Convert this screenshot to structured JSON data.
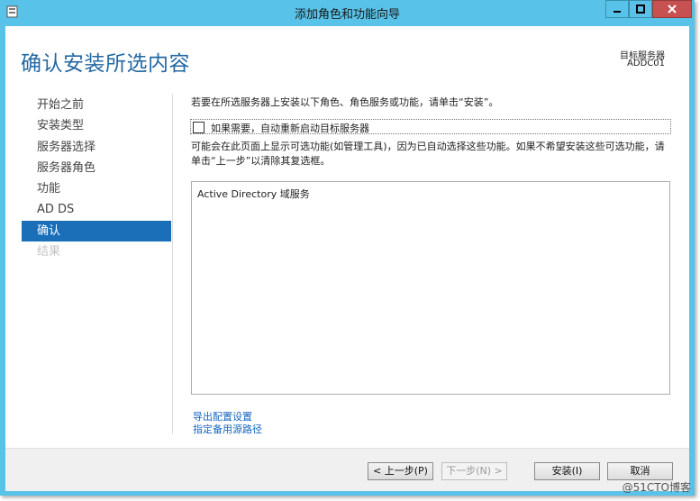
{
  "window": {
    "title": "添加角色和功能向导",
    "accent": "#58c2e8"
  },
  "header": {
    "heading": "确认安装所选内容",
    "target_label": "目标服务器",
    "target_value": "ADDC01"
  },
  "nav": {
    "items": [
      {
        "label": "开始之前",
        "state": "normal"
      },
      {
        "label": "安装类型",
        "state": "normal"
      },
      {
        "label": "服务器选择",
        "state": "normal"
      },
      {
        "label": "服务器角色",
        "state": "normal"
      },
      {
        "label": "功能",
        "state": "normal"
      },
      {
        "label": "AD DS",
        "state": "normal"
      },
      {
        "label": "确认",
        "state": "active"
      },
      {
        "label": "结果",
        "state": "disabled"
      }
    ]
  },
  "content": {
    "instruction": "若要在所选服务器上安装以下角色、角色服务或功能，请单击“安装”。",
    "restart_label": "如果需要，自动重新启动目标服务器",
    "restart_checked": false,
    "note": "可能会在此页面上显示可选功能(如管理工具)，因为已自动选择这些功能。如果不希望安装这些可选功能，请单击“上一步”以清除其复选框。",
    "items": [
      "Active Directory 域服务"
    ],
    "link_export": "导出配置设置",
    "link_alt_source": "指定备用源路径"
  },
  "footer": {
    "prev": "< 上一步(P)",
    "next": "下一步(N) >",
    "install": "安装(I)",
    "cancel": "取消"
  },
  "watermark": "@51CTO博客"
}
